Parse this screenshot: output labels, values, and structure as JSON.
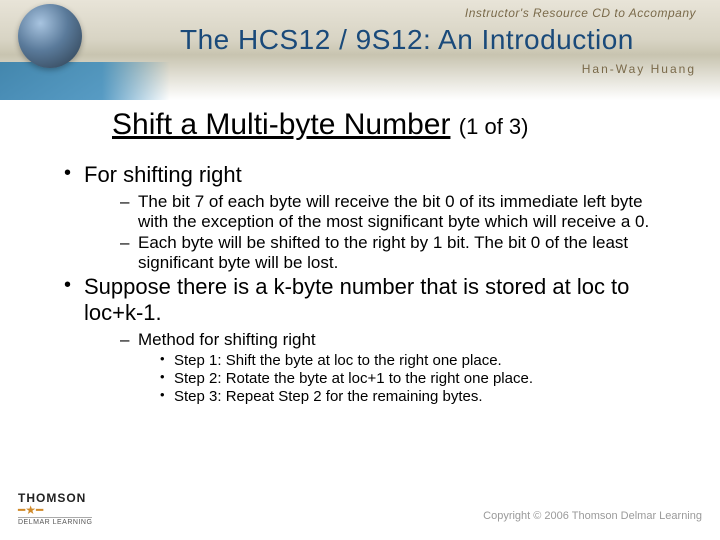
{
  "header": {
    "pretitle": "Instructor's Resource CD to Accompany",
    "title": "The HCS12 / 9S12: An Introduction",
    "author": "Han-Way Huang"
  },
  "slide": {
    "title_main": "Shift a Multi-byte Number",
    "title_sub": "(1 of 3)"
  },
  "bullets": {
    "l1a": "For shifting right",
    "l2a": "The bit 7 of each byte will receive the bit 0 of its immediate left byte with the exception of the most significant byte which will receive a 0.",
    "l2b": "Each byte will be shifted to the right by 1 bit.  The bit 0 of the least significant byte will be lost.",
    "l1b": "Suppose there is a k-byte number that is stored at loc to loc+k-1.",
    "l2c": "Method for shifting right",
    "l3a": "Step 1: Shift the byte at loc to the right one place.",
    "l3b": "Step 2: Rotate the byte at loc+1 to the right one place.",
    "l3c": "Step 3: Repeat Step 2 for the remaining bytes."
  },
  "footer": {
    "brand": "THOMSON",
    "subbrand": "DELMAR LEARNING",
    "copyright": "Copyright © 2006 Thomson Delmar Learning"
  }
}
